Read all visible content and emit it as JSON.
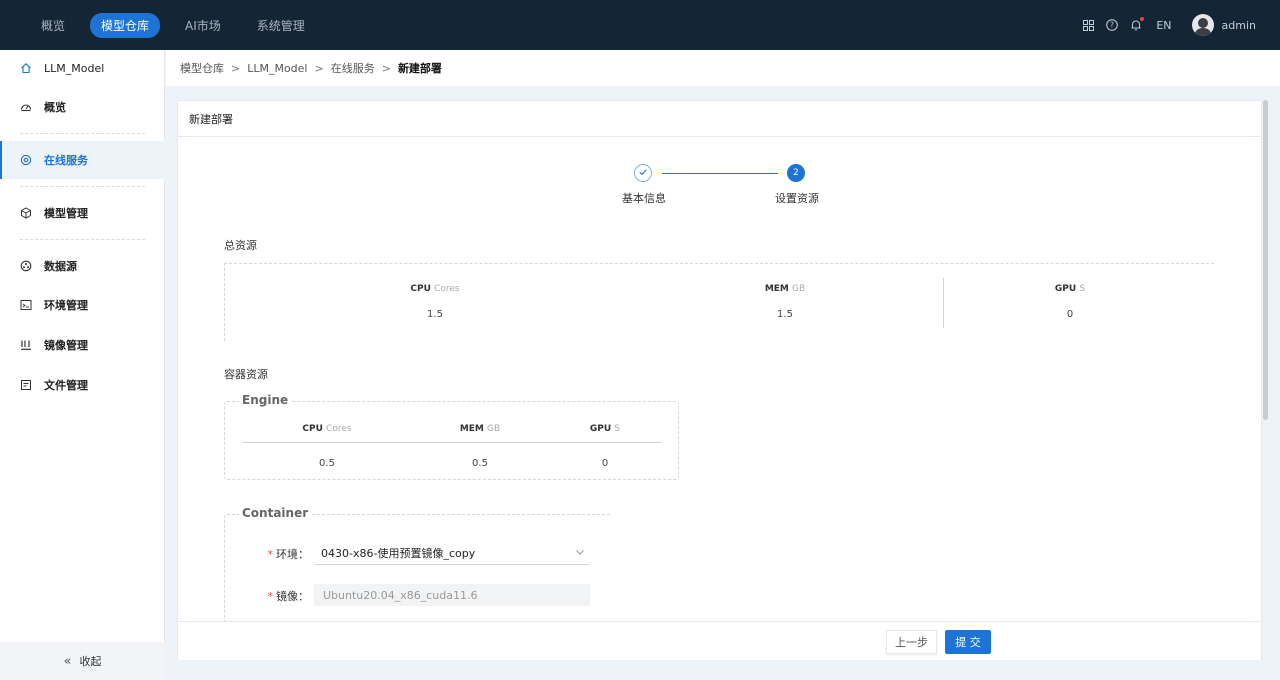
{
  "topnav": {
    "items": [
      {
        "label": "概览",
        "active": false
      },
      {
        "label": "模型仓库",
        "active": true
      },
      {
        "label": "AI市场",
        "active": false
      },
      {
        "label": "系统管理",
        "active": false
      }
    ],
    "lang": "EN",
    "username": "admin"
  },
  "sidebar": {
    "brand": "LLM_Model",
    "items": [
      {
        "label": "概览",
        "icon": "dashboard-icon"
      },
      {
        "label": "在线服务",
        "icon": "service-icon",
        "active": true
      },
      {
        "label": "模型管理",
        "icon": "cube-icon"
      },
      {
        "label": "数据源",
        "icon": "datasource-icon"
      },
      {
        "label": "环境管理",
        "icon": "environment-icon"
      },
      {
        "label": "镜像管理",
        "icon": "image-icon"
      },
      {
        "label": "文件管理",
        "icon": "file-icon"
      }
    ],
    "collapse_label": "收起"
  },
  "breadcrumb": {
    "items": [
      "模型仓库",
      "LLM_Model",
      "在线服务"
    ],
    "current": "新建部署",
    "separator": ">"
  },
  "card": {
    "title": "新建部署"
  },
  "steps": [
    {
      "number": "",
      "label": "基本信息",
      "status": "done"
    },
    {
      "number": "2",
      "label": "设置资源",
      "status": "active"
    }
  ],
  "total_resources": {
    "title": "总资源",
    "cpu": {
      "key": "CPU",
      "unit": "Cores",
      "value": "1.5"
    },
    "mem": {
      "key": "MEM",
      "unit": "GB",
      "value": "1.5"
    },
    "gpu": {
      "key": "GPU",
      "unit": "S",
      "value": "0"
    }
  },
  "container_resources": {
    "title": "容器资源",
    "engine": {
      "legend": "Engine",
      "cpu": {
        "key": "CPU",
        "unit": "Cores",
        "value": "0.5"
      },
      "mem": {
        "key": "MEM",
        "unit": "GB",
        "value": "0.5"
      },
      "gpu": {
        "key": "GPU",
        "unit": "S",
        "value": "0"
      }
    },
    "container": {
      "legend": "Container",
      "env_label": "环境：",
      "env_value": "0430-x86-使用预置镜像_copy",
      "image_label": "镜像：",
      "image_value": "Ubuntu20.04_x86_cuda11.6"
    }
  },
  "footer": {
    "prev_label": "上一步",
    "submit_label": "提 交"
  },
  "colors": {
    "primary": "#1e74d4",
    "topbar": "#142536",
    "required": "#e04848"
  }
}
